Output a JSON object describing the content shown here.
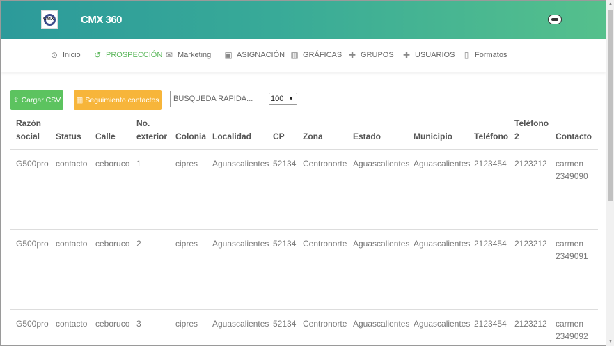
{
  "header": {
    "brand": "CMX 360",
    "logo_text": "CMX"
  },
  "nav": {
    "items": [
      {
        "label": "Inicio",
        "icon": "dashboard-icon"
      },
      {
        "label": "PROSPECCIÓN",
        "icon": "history-icon",
        "active": true
      },
      {
        "label": "Marketing",
        "icon": "mail-icon"
      },
      {
        "label": "ASIGNACIÓN",
        "icon": "calendar-check-icon"
      },
      {
        "label": "GRÁFICAS",
        "icon": "bar-chart-icon"
      },
      {
        "label": "GRUPOS",
        "icon": "group-add-icon"
      },
      {
        "label": "USUARIOS",
        "icon": "person-add-icon"
      },
      {
        "label": "Formatos",
        "icon": "document-icon"
      }
    ],
    "active_color": "#5cb85c"
  },
  "toolbar": {
    "upload_label": "Cargar CSV",
    "followup_label": "Seguimiento contactos",
    "search_placeholder": "BÚSQUEDA RÁPIDA...",
    "page_size": "100"
  },
  "table": {
    "headers": {
      "razon_1": "Razón",
      "razon_2": "social",
      "status": "Status",
      "calle": "Calle",
      "noext_1": "No.",
      "noext_2": "exterior",
      "colonia": "Colonia",
      "localidad": "Localidad",
      "cp": "CP",
      "zona": "Zona",
      "estado": "Estado",
      "municipio": "Municipio",
      "telefono": "Teléfono",
      "tel2_1": "Teléfono",
      "tel2_2": "2",
      "contacto": "Contacto"
    },
    "rows": [
      {
        "razon": "G500pro",
        "status": "contacto",
        "calle": "ceboruco",
        "noext": "1",
        "colonia": "cipres",
        "localidad": "Aguascalientes",
        "cp": "52134",
        "zona": "Centronorte",
        "estado": "Aguascalientes",
        "municipio": "Aguascalientes",
        "telefono": "2123454",
        "telefono2": "2123212",
        "contacto_1": "carmen",
        "contacto_2": "2349090"
      },
      {
        "razon": "G500pro",
        "status": "contacto",
        "calle": "ceboruco",
        "noext": "2",
        "colonia": "cipres",
        "localidad": "Aguascalientes",
        "cp": "52134",
        "zona": "Centronorte",
        "estado": "Aguascalientes",
        "municipio": "Aguascalientes",
        "telefono": "2123454",
        "telefono2": "2123212",
        "contacto_1": "carmen",
        "contacto_2": "2349091"
      },
      {
        "razon": "G500pro",
        "status": "contacto",
        "calle": "ceboruco",
        "noext": "3",
        "colonia": "cipres",
        "localidad": "Aguascalientes",
        "cp": "52134",
        "zona": "Centronorte",
        "estado": "Aguascalientes",
        "municipio": "Aguascalientes",
        "telefono": "2123454",
        "telefono2": "2123212",
        "contacto_1": "carmen",
        "contacto_2": "2349092"
      }
    ]
  },
  "colors": {
    "header_start": "#2c9a9a",
    "header_end": "#55c08c",
    "upload_button": "#5cc35f",
    "followup_button": "#f7b53a"
  }
}
